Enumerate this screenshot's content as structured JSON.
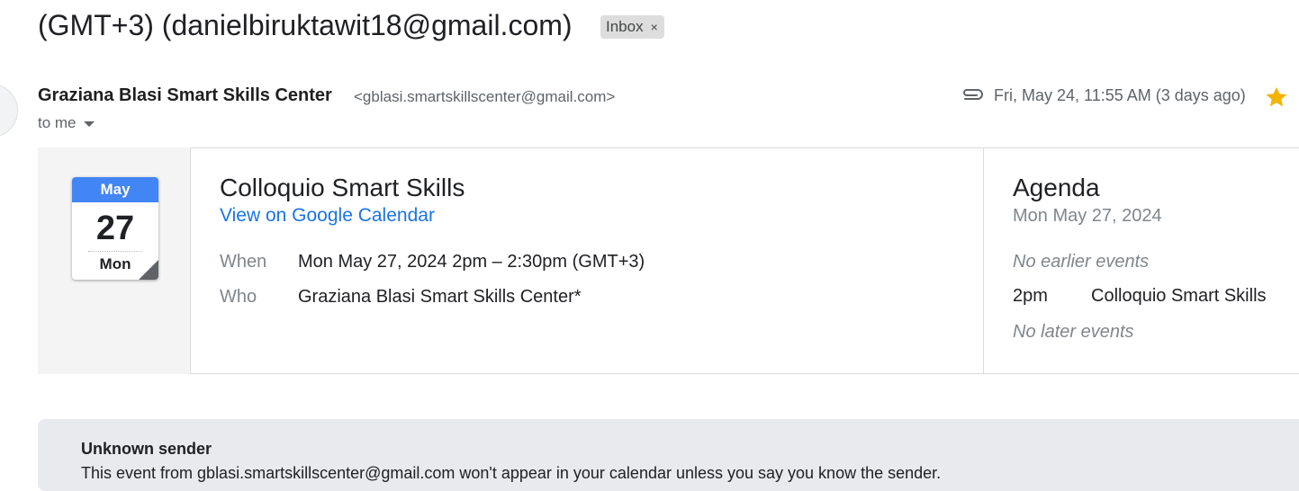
{
  "header": {
    "subject_line2": "(GMT+3) (danielbiruktawit18@gmail.com)",
    "label_chip": "Inbox",
    "label_close": "×"
  },
  "message": {
    "sender_name": "Graziana Blasi Smart Skills Center",
    "sender_email": "<gblasi.smartskillscenter@gmail.com>",
    "recipient": "to me",
    "date": "Fri, May 24, 11:55 AM (3 days ago)",
    "starred": true,
    "has_attachment": true
  },
  "calendar_icon": {
    "month": "May",
    "day": "27",
    "weekday": "Mon"
  },
  "event": {
    "title": "Colloquio Smart Skills",
    "link": "View on Google Calendar",
    "when_label": "When",
    "when_value": "Mon May 27, 2024 2pm – 2:30pm (GMT+3)",
    "who_label": "Who",
    "who_value": "Graziana Blasi Smart Skills Center*"
  },
  "agenda": {
    "title": "Agenda",
    "date": "Mon May 27, 2024",
    "earlier": "No earlier events",
    "time": "2pm",
    "event": "Colloquio Smart Skills",
    "later": "No later events"
  },
  "warning": {
    "title": "Unknown sender",
    "text": "This event from gblasi.smartskillscenter@gmail.com won't appear in your calendar unless you say you know the sender."
  },
  "colors": {
    "accent_blue": "#4285f4",
    "link_blue": "#1a73e8",
    "star_yellow": "#f4b400",
    "chip_bg": "#dddddd",
    "warning_bg": "#e9eaee"
  },
  "icons": {
    "attachment": "paperclip-icon",
    "star": "star-icon",
    "caret": "chevron-down-icon"
  }
}
